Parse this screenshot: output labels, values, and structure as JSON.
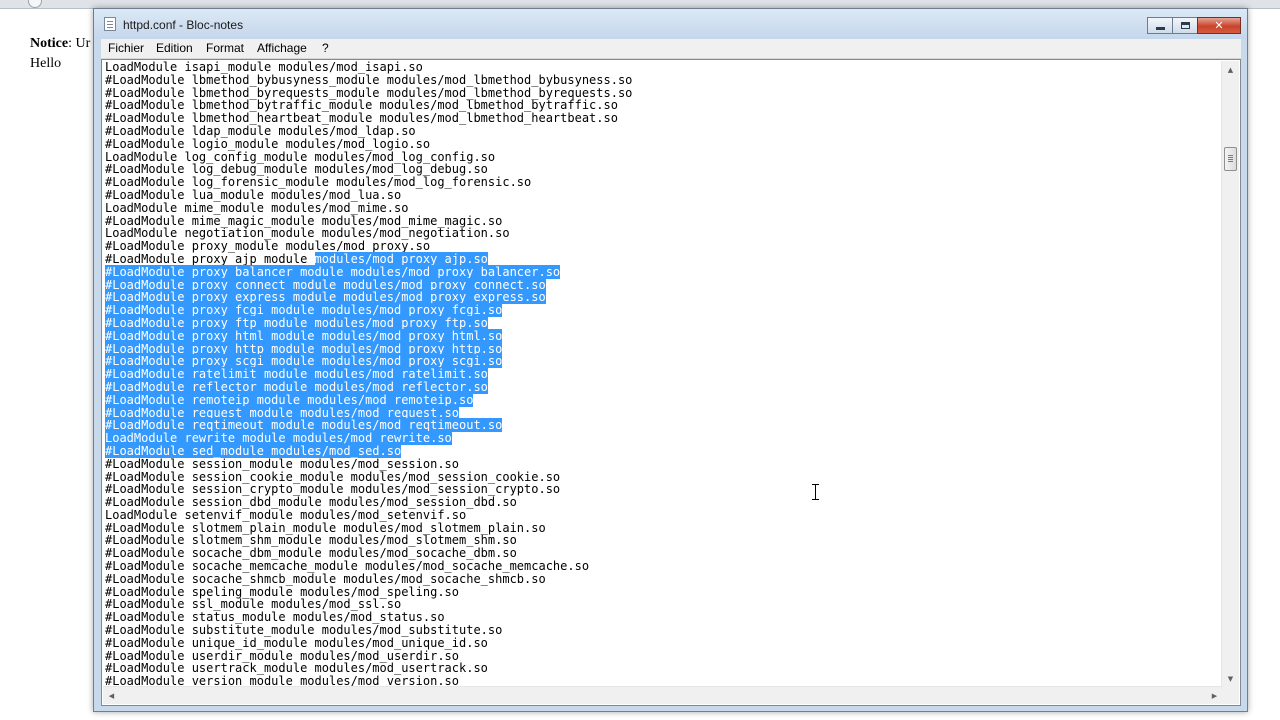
{
  "background": {
    "notice_label": "Notice",
    "notice_rest": ": Ur",
    "hello": "Hello"
  },
  "window": {
    "title": "httpd.conf - Bloc-notes",
    "icon": "notepad-icon"
  },
  "menu": [
    "Fichier",
    "Edition",
    "Format",
    "Affichage",
    "?"
  ],
  "colors": {
    "selection": "#3399ff",
    "title_bar": "#c9d9ec",
    "close_button": "#c7432b"
  },
  "editor": {
    "lines": [
      {
        "pre": "LoadModule isapi_module modules/mod_isapi.so",
        "sel": ""
      },
      {
        "pre": "#LoadModule lbmethod_bybusyness_module modules/mod_lbmethod_bybusyness.so",
        "sel": ""
      },
      {
        "pre": "#LoadModule lbmethod_byrequests_module modules/mod_lbmethod_byrequests.so",
        "sel": ""
      },
      {
        "pre": "#LoadModule lbmethod_bytraffic_module modules/mod_lbmethod_bytraffic.so",
        "sel": ""
      },
      {
        "pre": "#LoadModule lbmethod_heartbeat_module modules/mod_lbmethod_heartbeat.so",
        "sel": ""
      },
      {
        "pre": "#LoadModule ldap_module modules/mod_ldap.so",
        "sel": ""
      },
      {
        "pre": "#LoadModule logio_module modules/mod_logio.so",
        "sel": ""
      },
      {
        "pre": "LoadModule log_config_module modules/mod_log_config.so",
        "sel": ""
      },
      {
        "pre": "#LoadModule log_debug_module modules/mod_log_debug.so",
        "sel": ""
      },
      {
        "pre": "#LoadModule log_forensic_module modules/mod_log_forensic.so",
        "sel": ""
      },
      {
        "pre": "#LoadModule lua_module modules/mod_lua.so",
        "sel": ""
      },
      {
        "pre": "LoadModule mime_module modules/mod_mime.so",
        "sel": ""
      },
      {
        "pre": "#LoadModule mime_magic_module modules/mod_mime_magic.so",
        "sel": ""
      },
      {
        "pre": "LoadModule negotiation_module modules/mod_negotiation.so",
        "sel": ""
      },
      {
        "pre": "#LoadModule proxy_module modules/mod_proxy.so",
        "sel": ""
      },
      {
        "pre": "#LoadModule proxy_ajp_module ",
        "sel": "modules/mod_proxy_ajp.so"
      },
      {
        "pre": "",
        "sel": "#LoadModule proxy_balancer_module modules/mod_proxy_balancer.so"
      },
      {
        "pre": "",
        "sel": "#LoadModule proxy_connect_module modules/mod_proxy_connect.so"
      },
      {
        "pre": "",
        "sel": "#LoadModule proxy_express_module modules/mod_proxy_express.so"
      },
      {
        "pre": "",
        "sel": "#LoadModule proxy_fcgi_module modules/mod_proxy_fcgi.so"
      },
      {
        "pre": "",
        "sel": "#LoadModule proxy_ftp_module modules/mod_proxy_ftp.so"
      },
      {
        "pre": "",
        "sel": "#LoadModule proxy_html_module modules/mod_proxy_html.so"
      },
      {
        "pre": "",
        "sel": "#LoadModule proxy_http_module modules/mod_proxy_http.so"
      },
      {
        "pre": "",
        "sel": "#LoadModule proxy_scgi_module modules/mod_proxy_scgi.so"
      },
      {
        "pre": "",
        "sel": "#LoadModule ratelimit_module modules/mod_ratelimit.so"
      },
      {
        "pre": "",
        "sel": "#LoadModule reflector_module modules/mod_reflector.so"
      },
      {
        "pre": "",
        "sel": "#LoadModule remoteip_module modules/mod_remoteip.so"
      },
      {
        "pre": "",
        "sel": "#LoadModule request_module modules/mod_request.so"
      },
      {
        "pre": "",
        "sel": "#LoadModule reqtimeout_module modules/mod_reqtimeout.so"
      },
      {
        "pre": "",
        "sel": "LoadModule rewrite_module modules/mod_rewrite.so"
      },
      {
        "pre": "",
        "sel": "#LoadModule sed_module modules/mod_sed.so"
      },
      {
        "pre": "#LoadModule session_module modules/mod_session.so",
        "sel": ""
      },
      {
        "pre": "#LoadModule session_cookie_module modules/mod_session_cookie.so",
        "sel": ""
      },
      {
        "pre": "#LoadModule session_crypto_module modules/mod_session_crypto.so",
        "sel": ""
      },
      {
        "pre": "#LoadModule session_dbd_module modules/mod_session_dbd.so",
        "sel": ""
      },
      {
        "pre": "LoadModule setenvif_module modules/mod_setenvif.so",
        "sel": ""
      },
      {
        "pre": "#LoadModule slotmem_plain_module modules/mod_slotmem_plain.so",
        "sel": ""
      },
      {
        "pre": "#LoadModule slotmem_shm_module modules/mod_slotmem_shm.so",
        "sel": ""
      },
      {
        "pre": "#LoadModule socache_dbm_module modules/mod_socache_dbm.so",
        "sel": ""
      },
      {
        "pre": "#LoadModule socache_memcache_module modules/mod_socache_memcache.so",
        "sel": ""
      },
      {
        "pre": "#LoadModule socache_shmcb_module modules/mod_socache_shmcb.so",
        "sel": ""
      },
      {
        "pre": "#LoadModule speling_module modules/mod_speling.so",
        "sel": ""
      },
      {
        "pre": "#LoadModule ssl_module modules/mod_ssl.so",
        "sel": ""
      },
      {
        "pre": "#LoadModule status_module modules/mod_status.so",
        "sel": ""
      },
      {
        "pre": "#LoadModule substitute_module modules/mod_substitute.so",
        "sel": ""
      },
      {
        "pre": "#LoadModule unique_id_module modules/mod_unique_id.so",
        "sel": ""
      },
      {
        "pre": "#LoadModule userdir_module modules/mod_userdir.so",
        "sel": ""
      },
      {
        "pre": "#LoadModule usertrack_module modules/mod_usertrack.so",
        "sel": ""
      },
      {
        "pre": "#LoadModule version_module modules/mod_version.so",
        "sel": ""
      }
    ]
  }
}
